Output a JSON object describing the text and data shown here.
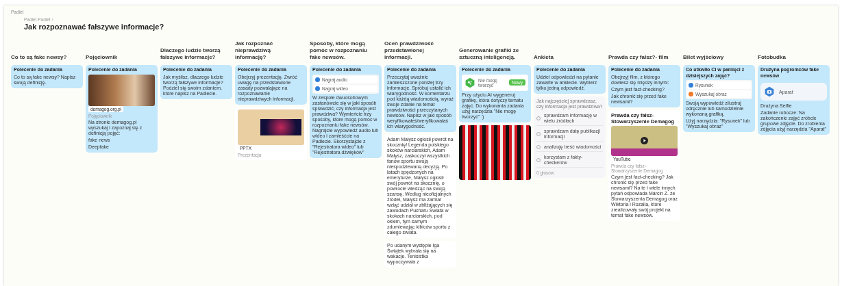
{
  "header": {
    "label": "Padlet",
    "breadcrumb": "Padlet Padlet ›",
    "title": "Jak rozpoznawać fałszywe informacje?"
  },
  "columns": [
    {
      "title": "Co to są fake newsy?",
      "posts": [
        {
          "kind": "task",
          "heading": "Polecenie do zadania",
          "body": [
            "Co to są fake newsy? Napisz swoją definicję."
          ]
        }
      ]
    },
    {
      "title": "Pojęciownik",
      "posts": [
        {
          "kind": "task",
          "heading": "Polecenie do zadania",
          "attachment": {
            "kind": "image",
            "badge": "demagog.org.pl",
            "caption": "Pojęciownik"
          },
          "body": [
            "Na stronie demagog.pl wyszukaj i zapoznaj się z definicją pojęć:",
            "fake news",
            "Deepfake"
          ]
        }
      ]
    },
    {
      "title": "Dlaczego ludzie tworzą fałszywe informacje?",
      "posts": [
        {
          "kind": "task",
          "heading": "Polecenie do zadania",
          "body": [
            "Jak myślisz, dlaczego ludzie tworzą fałszywe informacje? Podziel się swoim zdaniem, które napisz na Padlecie."
          ]
        }
      ]
    },
    {
      "title": "Jak rozpoznać nieprawdziwą informację?",
      "posts": [
        {
          "kind": "task",
          "heading": "Polecenie do zadania",
          "body": [
            "Obejrzyj prezentację. Zwróć uwagę na przedstawione zasady pozwalające na rozpoznawanie nieprawdziwych informacji."
          ]
        },
        {
          "kind": "media",
          "badge": "PPTX",
          "caption": "Prezentacja"
        }
      ]
    },
    {
      "title": "Sposoby, które mogą pomóc w rozpoznaniu fake newsów.",
      "posts": [
        {
          "kind": "task",
          "heading": "Polecenie do zadania",
          "attachment": {
            "kind": "links",
            "items": [
              {
                "label": "Nagraj audio",
                "color": "#2f7fd8"
              },
              {
                "label": "Nagraj wideo",
                "color": "#2f7fd8"
              }
            ]
          },
          "body": [
            "W zespole dwuosobowym zastanówcie się w jaki sposób sprawdzić, czy informacja jest prawdziwa? Wymieńcie trzy sposoby, które mogą pomóc w rozpoznaniu fake newsów. Nagrajcie wypowiedź audio lub wideo i zamieśćcie na Padlecie. Skorzystajcie z \"Rejestratora wideo\" lub \"Rejestratora dźwięków\""
          ]
        }
      ]
    },
    {
      "title": "Oceń prawdziwość przedstawionej informacji.",
      "posts": [
        {
          "kind": "task",
          "heading": "Polecenie do zadania",
          "body": [
            "Przeczytaj uważnie zamieszczone poniżej trzy informacje. Spróbuj ustalić ich wiarygodność. W komentarzu pod każdą wiadomością, wyraź swoje zdanie na temat prawdziwości przeczytanych newsów. Napisz w jaki sposób weryfikowałeś/weryfikowałaś ich wiarygodność."
          ]
        },
        {
          "kind": "text",
          "body": [
            "Adam Małysz ogłosił powrót na skocznię! Legenda polskiego skoków narciarskich, Adam Małysz, zaskoczył wszystkich fanów sportu swoją niespodziewaną decyzją. Po latach spędzonych na emeryturze, Małysz ogłosił swój powrót na skocznię, o powrocie wiedząc na swoją szansę. Według nieoficjalnych źródeł, Małysz ma zamiar wziąć udział w zbliżających się zawodach Pucharu Świata w skokach narciarskich, pod okiem, tym samym zdumiewając kibiców sportu z całego świata."
          ]
        },
        {
          "kind": "text",
          "body": [
            "Po udanym występie Iga Świątek wybrała się na wakacje. Tenisistka wypoczywała z"
          ]
        }
      ]
    },
    {
      "title": "Generowanie grafiki ze sztuczną inteligencją.",
      "posts": [
        {
          "kind": "task",
          "heading": "Polecenie do zadania",
          "attachment": {
            "kind": "app",
            "name": "Nie mogę tworzyć",
            "action": "Nowy"
          },
          "body": [
            "Przy użyciu AI wygeneruj grafikę, która dotyczy tematu zajęć. Do wykonania zadania użyj narzędzia \"Nie mogę tworzyć\" :)"
          ]
        },
        {
          "kind": "collage"
        }
      ]
    },
    {
      "title": "Ankieta",
      "posts": [
        {
          "kind": "task",
          "heading": "Polecenie do zadania",
          "body": [
            "Udziel odpowiedzi na pytanie zawarte w ankiecie. Wybierz tylko jedną odpowiedź."
          ]
        },
        {
          "kind": "poll",
          "question": "Jak najczęściej sprawdzasz, czy informacja jest prawdziwa?",
          "options": [
            {
              "label": "sprawdzam informację w wielu źródłach",
              "selected": false
            },
            {
              "label": "sprawdzam datę publikacji informacji",
              "selected": false
            },
            {
              "label": "analizuję treść wiadomości",
              "selected": false
            },
            {
              "label": "korzystam z fakty-checkerów",
              "selected": false
            }
          ],
          "footer": "0 głosów"
        }
      ]
    },
    {
      "title": "Prawda czy fałsz?- film",
      "posts": [
        {
          "kind": "task",
          "heading": "Polecenie do zadania",
          "body": [
            "Obejrzyj film, z którego dowiesz się między innymi:",
            "Czym jest fact-checking?",
            "Jak chronić się przed fake newsami?"
          ]
        },
        {
          "kind": "video",
          "title": "Prawda czy fałsz- Stowarzyszenie Demagog",
          "badge": "YouTube",
          "caption": "Prawda czy fałsz- Stowarzyszenie Demagog",
          "body": [
            "Czym jest fact-checking? Jak chronić się przed fake newsami? Na te i wiele innych pytań odpowiada Marcin Z. ze Stowarzyszenia Demagog oraz Wiktoria i Rozalia, które zrealizowały swój projekt na temat fake newsów."
          ]
        }
      ]
    },
    {
      "title": "Bilet wyjściowy",
      "posts": [
        {
          "kind": "task",
          "heading": "Co utkwiło Ci w pamięci z dzisiejszych zajęć?",
          "attachment": {
            "kind": "links",
            "items": [
              {
                "label": "Rysunek",
                "color": "#2f7fd8"
              },
              {
                "label": "Wyszukaj obraz",
                "color": "#f07a2a"
              }
            ]
          },
          "body": [
            "Swoją wypowiedź zilustruj odręcznie lub samodzielnie wykonaną grafiką.",
            "Użyj narzędzia: \"Rysunek\" lub \"Wyszukaj obraz\""
          ]
        }
      ]
    },
    {
      "title": "Fotobudka",
      "posts": [
        {
          "kind": "task",
          "heading": "Drużyna pogromców fake newsów",
          "attachment": {
            "kind": "camera",
            "label": "Aparat"
          },
          "body": [
            "Drużyna Selfie",
            "Zadanie robocze: Na zakończenie zajęć zróbcie grupowe zdjęcie. Do zrobienia zdjęcia użyj narzędzia \"Aparat\""
          ]
        }
      ]
    }
  ]
}
